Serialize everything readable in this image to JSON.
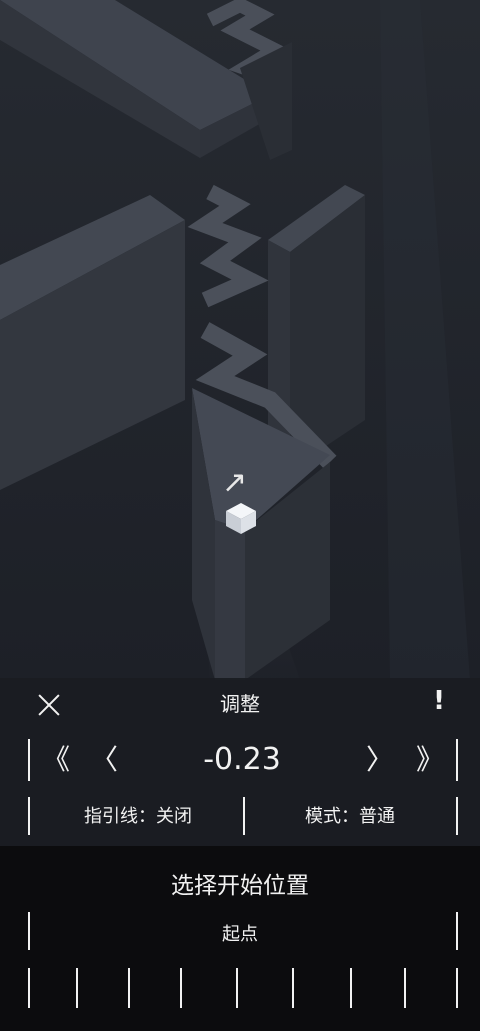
{
  "scene": {
    "colors": {
      "background": "#1f2229",
      "wall_top": "#3d424c",
      "wall_side": "#2b2f37",
      "cube": "#e6e9ee"
    },
    "arrow": "↗"
  },
  "panel": {
    "title": "调整",
    "close_icon": "close-icon",
    "info_label": "!",
    "nav_first": "《",
    "nav_prev": "〈",
    "value": "-0.23",
    "nav_next": "〉",
    "nav_last": "》",
    "guide_option": "指引线：关闭",
    "mode_option": "模式：普通"
  },
  "start_panel": {
    "title": "选择开始位置",
    "start_label": "起点"
  }
}
